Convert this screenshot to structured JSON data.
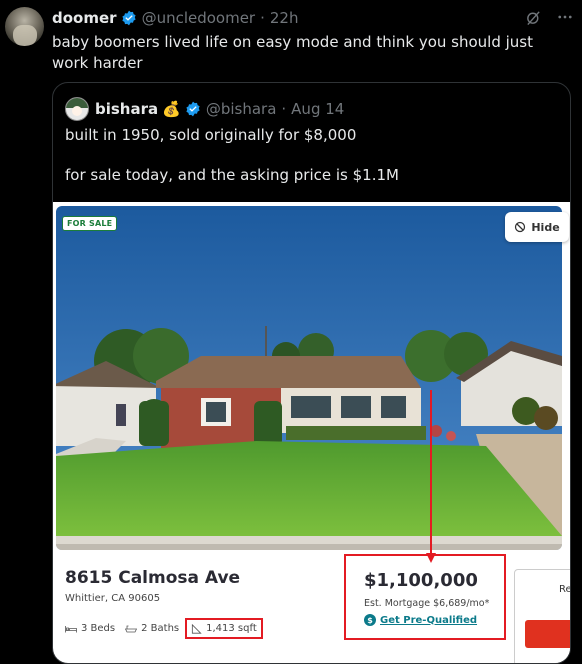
{
  "tweet": {
    "author_name": "doomer",
    "handle": "@uncledoomer",
    "time": "22h",
    "separator": "·",
    "text": "baby boomers lived life on easy mode and think you should just work harder"
  },
  "quote": {
    "author_name": "bishara",
    "emoji": "💰",
    "handle": "@bishara",
    "time": "Aug 14",
    "separator": "·",
    "line1": "built in 1950, sold originally for $8,000",
    "line2": "for sale today, and the asking price is $1.1M"
  },
  "listing": {
    "badge": "FOR SALE",
    "hide_label": "Hide",
    "address": "8615 Calmosa Ave",
    "city": "Whittier, CA 90605",
    "beds": "3 Beds",
    "baths": "2 Baths",
    "sqft": "1,413 sqft",
    "price": "$1,100,000",
    "mortgage": "Est. Mortgage $6,689/mo*",
    "prequal_label": "Get Pre-Qualified",
    "prequal_icon": "$",
    "side_text": "Re"
  },
  "colors": {
    "verified": "#1d9bf0",
    "highlight": "#e31b23",
    "accent_teal": "#0b7a8a",
    "background": "#000000"
  }
}
